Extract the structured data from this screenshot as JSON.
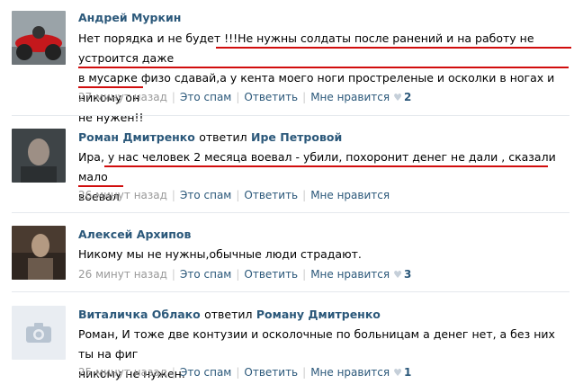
{
  "comments": [
    {
      "author": "Андрей Муркин",
      "verb": "",
      "reply_to": "",
      "lines": [
        "Нет порядка и не будет !!!Не нужны солдаты после ранений и на работу не устроится даже",
        "в мусарке физо сдавай,а у кента моего ноги простреленые и осколки в ногах и никому он",
        "не нужен!!"
      ],
      "time": "27 минут назад",
      "spam": "Это спам",
      "reply": "Ответить",
      "like": "Мне нравится",
      "likes": "2"
    },
    {
      "author": "Роман Дмитренко",
      "verb": "ответил",
      "reply_to": "Ире Петровой",
      "lines": [
        "Ира, у нас человек 2 месяца воевал - убили, похоронит денег не дали , сказали мало",
        "воевал"
      ],
      "time": "26 минут назад",
      "spam": "Это спам",
      "reply": "Ответить",
      "like": "Мне нравится",
      "likes": ""
    },
    {
      "author": "Алексей Архипов",
      "verb": "",
      "reply_to": "",
      "lines": [
        "Никому мы не нужны,обычные люди страдают."
      ],
      "time": "26 минут назад",
      "spam": "Это спам",
      "reply": "Ответить",
      "like": "Мне нравится",
      "likes": "3"
    },
    {
      "author": "Виталичка Облако",
      "verb": "ответил",
      "reply_to": "Роману Дмитренко",
      "lines": [
        "Роман, И тоже две контузии и осколочные по больницам а денег нет, а без них ты на фиг",
        "никому не нужен."
      ],
      "time": "25 минут назад",
      "spam": "Это спам",
      "reply": "Ответить",
      "like": "Мне нравится",
      "likes": "1"
    }
  ],
  "colors": {
    "link": "#2b587a",
    "meta_gray": "#999999",
    "underline": "#d10d0d"
  }
}
